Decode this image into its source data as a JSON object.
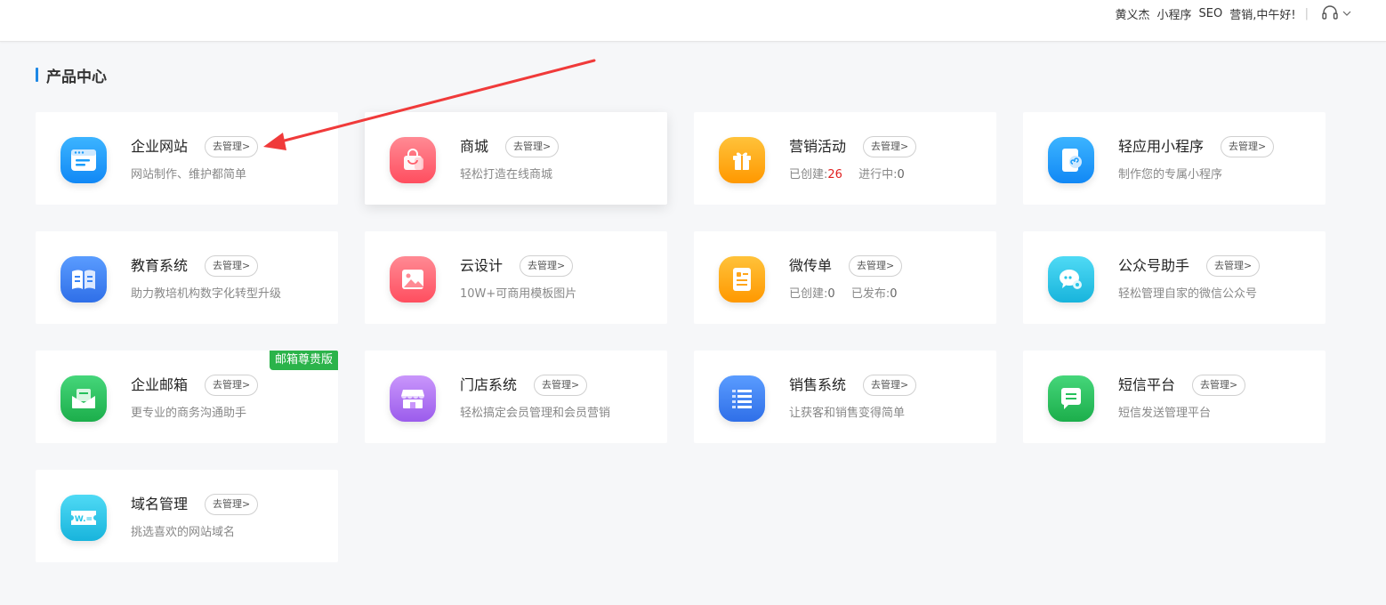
{
  "topbar": {
    "user": "黄义杰",
    "links": [
      "小程序",
      "SEO",
      "营销"
    ],
    "greeting": ",中午好!",
    "separator": "|"
  },
  "section": {
    "title": "产品中心"
  },
  "cards": [
    {
      "title": "企业网站",
      "manage": "去管理>",
      "desc": "网站制作、维护都简单",
      "icon": "website-icon",
      "color": "#1a9dfb"
    },
    {
      "title": "商城",
      "manage": "去管理>",
      "desc": "轻松打造在线商城",
      "icon": "shopping-bag-icon",
      "color": "#ff5d6a"
    },
    {
      "title": "营销活动",
      "manage": "去管理>",
      "desc_label1": "已创建:",
      "desc_val1": "26",
      "desc_label2": "进行中:",
      "desc_val2": "0",
      "icon": "gift-icon",
      "color": "#ffa51a"
    },
    {
      "title": "轻应用小程序",
      "manage": "去管理>",
      "desc": "制作您的专属小程序",
      "icon": "mini-program-icon",
      "color": "#1a9dfb"
    },
    {
      "title": "教育系统",
      "manage": "去管理>",
      "desc": "助力教培机构数字化转型升级",
      "icon": "book-icon",
      "color": "#3a84f5"
    },
    {
      "title": "云设计",
      "manage": "去管理>",
      "desc": "10W+可商用模板图片",
      "icon": "image-icon",
      "color": "#ff5d6a"
    },
    {
      "title": "微传单",
      "manage": "去管理>",
      "desc_label1": "已创建:",
      "desc_val1": "0",
      "desc_label2": "已发布:",
      "desc_val2": "0",
      "icon": "flyer-icon",
      "color": "#ffa51a"
    },
    {
      "title": "公众号助手",
      "manage": "去管理>",
      "desc": "轻松管理自家的微信公众号",
      "icon": "wechat-icon",
      "color": "#26c6e8"
    },
    {
      "title": "企业邮箱",
      "manage": "去管理>",
      "desc": "更专业的商务沟通助手",
      "badge": "邮箱尊贵版",
      "icon": "mail-icon",
      "color": "#25c05b"
    },
    {
      "title": "门店系统",
      "manage": "去管理>",
      "desc": "轻松搞定会员管理和会员营销",
      "icon": "store-icon",
      "color": "#b575f0"
    },
    {
      "title": "销售系统",
      "manage": "去管理>",
      "desc": "让获客和销售变得简单",
      "icon": "list-icon",
      "color": "#3a84f5"
    },
    {
      "title": "短信平台",
      "manage": "去管理>",
      "desc": "短信发送管理平台",
      "icon": "sms-icon",
      "color": "#25c05b"
    },
    {
      "title": "域名管理",
      "manage": "去管理>",
      "desc": "挑选喜欢的网站域名",
      "icon": "domain-icon",
      "color": "#26c6e8"
    }
  ],
  "colors": {
    "accent": "#1e88e5",
    "highlight": "#e02020",
    "badge": "#2bb34a",
    "arrow": "#f03a3a"
  }
}
